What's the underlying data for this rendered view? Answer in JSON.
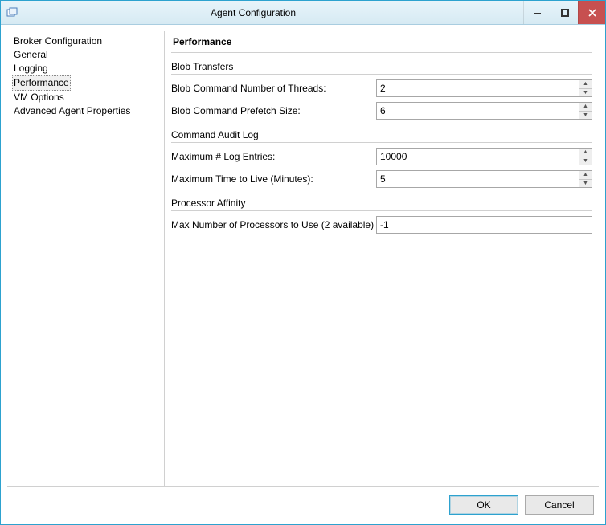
{
  "window": {
    "title": "Agent Configuration"
  },
  "sidebar": {
    "items": [
      {
        "label": "Broker Configuration",
        "selected": false
      },
      {
        "label": "General",
        "selected": false
      },
      {
        "label": "Logging",
        "selected": false
      },
      {
        "label": "Performance",
        "selected": true
      },
      {
        "label": "VM Options",
        "selected": false
      },
      {
        "label": "Advanced Agent Properties",
        "selected": false
      }
    ]
  },
  "panel": {
    "heading": "Performance",
    "groups": {
      "blob": {
        "title": "Blob Transfers",
        "threads_label": "Blob Command Number of Threads:",
        "threads_value": "2",
        "prefetch_label": "Blob Command Prefetch Size:",
        "prefetch_value": "6"
      },
      "audit": {
        "title": "Command Audit Log",
        "max_entries_label": "Maximum # Log Entries:",
        "max_entries_value": "10000",
        "ttl_label": "Maximum Time to Live (Minutes):",
        "ttl_value": "5"
      },
      "affinity": {
        "title": "Processor Affinity",
        "max_proc_label": "Max Number of Processors to Use (2 available)",
        "max_proc_value": "-1"
      }
    }
  },
  "footer": {
    "ok": "OK",
    "cancel": "Cancel"
  }
}
